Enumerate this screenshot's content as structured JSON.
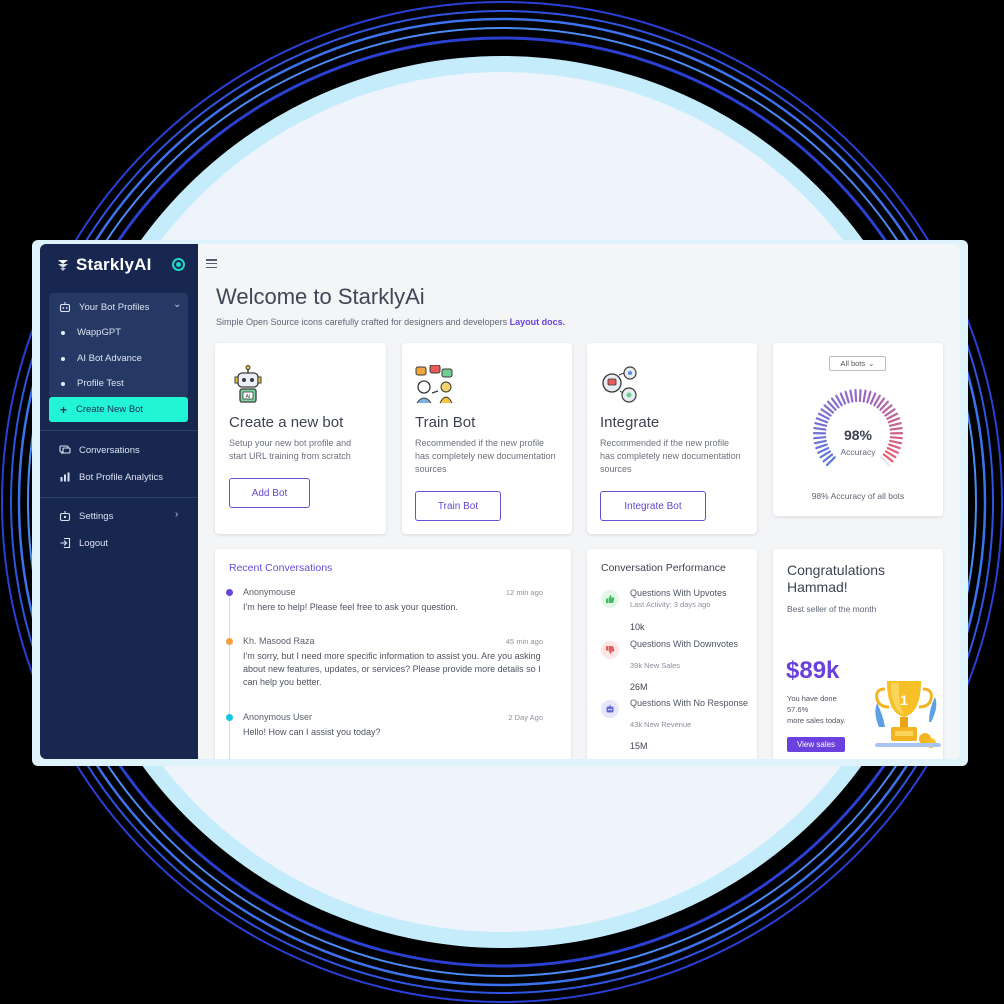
{
  "app": {
    "brand": "StarklyAI"
  },
  "sidebar": {
    "profiles_header": "Your Bot Profiles",
    "profiles": [
      "WappGPT",
      "AI Bot Advance",
      "Profile Test"
    ],
    "create_new": "Create New Bot",
    "items": [
      "Conversations",
      "Bot Profile Analytics"
    ],
    "settings": "Settings",
    "logout": "Logout"
  },
  "header": {
    "title": "Welcome to StarklyAi",
    "subtitle": "Simple Open Source icons carefully crafted for designers and developers ",
    "subtitle_link": "Layout docs."
  },
  "cards": {
    "create": {
      "title": "Create a new bot",
      "desc": "Setup your new bot profile and start URL training from scratch",
      "button": "Add Bot"
    },
    "train": {
      "title": "Train Bot",
      "desc": "Recommended if the new profile has completely new documentation sources",
      "button": "Train Bot"
    },
    "integrate": {
      "title": "Integrate",
      "desc": "Recommended if the new profile has completely new documentation sources",
      "button": "Integrate Bot"
    }
  },
  "accuracy": {
    "filter": "All bots",
    "value": "98%",
    "label": "Accuracy",
    "fraction": 0.98,
    "caption": "98% Accuracy of all bots"
  },
  "recent": {
    "title": "Recent Conversations",
    "items": [
      {
        "name": "Anonymouse",
        "time": "12 min ago",
        "msg": "I'm here to help! Please feel free to ask your question.",
        "color": "#6b45d6"
      },
      {
        "name": "Kh. Masood Raza",
        "time": "45 min ago",
        "msg": "I'm sorry, but I need more specific information to assist you. Are you asking about new features, updates, or services? Please provide more details so I can help you better.",
        "color": "#f5a142"
      },
      {
        "name": "Anonymous User",
        "time": "2 Day Ago",
        "msg": "Hello! How can I assist you today?",
        "color": "#12c8e0"
      }
    ]
  },
  "performance": {
    "title": "Conversation Performance",
    "rows": [
      {
        "name": "Questions With Upvotes",
        "sub": "Last Activity: 3 days ago",
        "value": "10k",
        "bg": "#e4f7e8",
        "fg": "#3fbf5f"
      },
      {
        "name": "Questions With Downvotes",
        "sub": "39k New Sales",
        "value": "26M",
        "bg": "#fde6e6",
        "fg": "#e35d5d"
      },
      {
        "name": "Questions With No Response",
        "sub": "43k New Revenue",
        "value": "15M",
        "bg": "#e6e7fb",
        "fg": "#6366d6"
      }
    ]
  },
  "congrats": {
    "title": "Congratulations Hammad!",
    "sub": "Best seller of the month",
    "amount": "$89k",
    "line1": "You have done",
    "line2": "57.6%",
    "line3": "more sales today.",
    "button": "View sales"
  },
  "colors": {
    "sidebar": "#172750",
    "accent": "#21f5d5",
    "primary": "#6a41de"
  }
}
